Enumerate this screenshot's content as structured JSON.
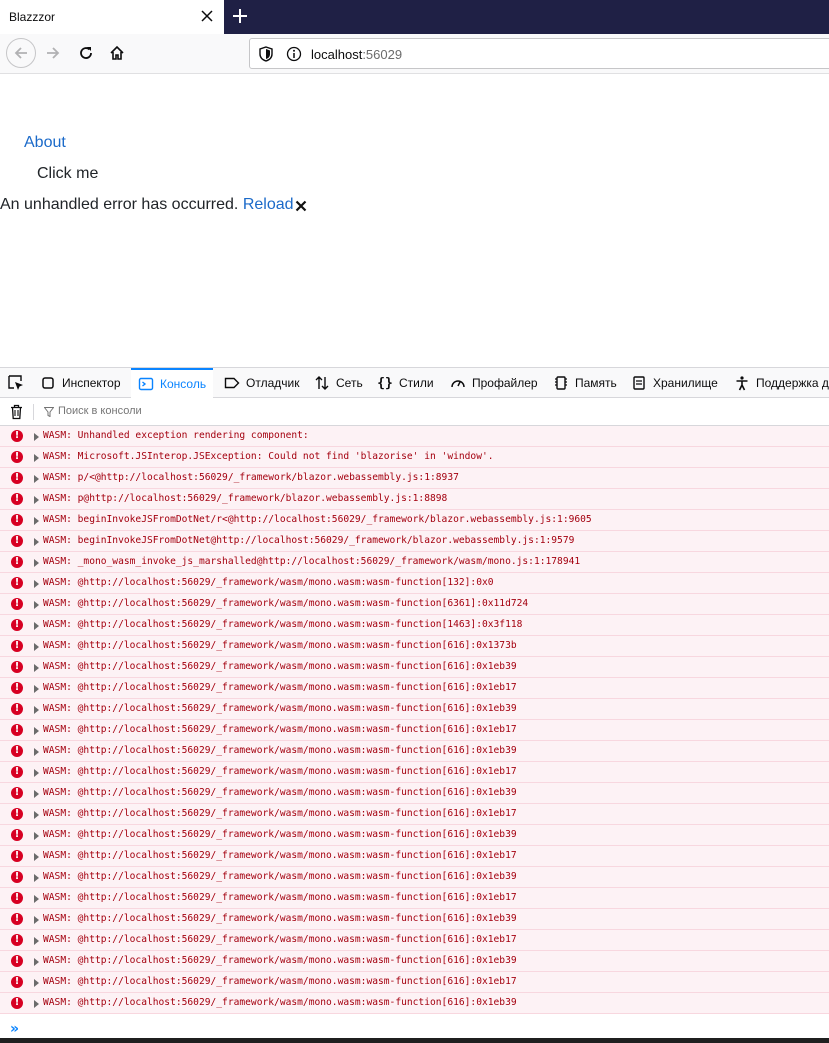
{
  "browser": {
    "tab_title": "Blazzzor",
    "url_host": "localhost",
    "url_port": ":56029"
  },
  "page": {
    "about_link": "About",
    "click_button": "Click me",
    "error_text": "An unhandled error has occurred.",
    "reload_link": "Reload"
  },
  "devtools": {
    "tabs": [
      "Инспектор",
      "Консоль",
      "Отладчик",
      "Сеть",
      "Стили",
      "Профайлер",
      "Память",
      "Хранилище",
      "Поддержка д"
    ],
    "active_tab": "Консоль",
    "filter_placeholder": "Поиск в консоли",
    "messages": [
      "WASM: Unhandled exception rendering component:",
      "WASM: Microsoft.JSInterop.JSException: Could not find 'blazorise' in 'window'.",
      "WASM: p/<@http://localhost:56029/_framework/blazor.webassembly.js:1:8937",
      "WASM: p@http://localhost:56029/_framework/blazor.webassembly.js:1:8898",
      "WASM: beginInvokeJSFromDotNet/r<@http://localhost:56029/_framework/blazor.webassembly.js:1:9605",
      "WASM: beginInvokeJSFromDotNet@http://localhost:56029/_framework/blazor.webassembly.js:1:9579",
      "WASM: _mono_wasm_invoke_js_marshalled@http://localhost:56029/_framework/wasm/mono.js:1:178941",
      "WASM: @http://localhost:56029/_framework/wasm/mono.wasm:wasm-function[132]:0x0",
      "WASM: @http://localhost:56029/_framework/wasm/mono.wasm:wasm-function[6361]:0x11d724",
      "WASM: @http://localhost:56029/_framework/wasm/mono.wasm:wasm-function[1463]:0x3f118",
      "WASM: @http://localhost:56029/_framework/wasm/mono.wasm:wasm-function[616]:0x1373b",
      "WASM: @http://localhost:56029/_framework/wasm/mono.wasm:wasm-function[616]:0x1eb39",
      "WASM: @http://localhost:56029/_framework/wasm/mono.wasm:wasm-function[616]:0x1eb17",
      "WASM: @http://localhost:56029/_framework/wasm/mono.wasm:wasm-function[616]:0x1eb39",
      "WASM: @http://localhost:56029/_framework/wasm/mono.wasm:wasm-function[616]:0x1eb17",
      "WASM: @http://localhost:56029/_framework/wasm/mono.wasm:wasm-function[616]:0x1eb39",
      "WASM: @http://localhost:56029/_framework/wasm/mono.wasm:wasm-function[616]:0x1eb17",
      "WASM: @http://localhost:56029/_framework/wasm/mono.wasm:wasm-function[616]:0x1eb39",
      "WASM: @http://localhost:56029/_framework/wasm/mono.wasm:wasm-function[616]:0x1eb17",
      "WASM: @http://localhost:56029/_framework/wasm/mono.wasm:wasm-function[616]:0x1eb39",
      "WASM: @http://localhost:56029/_framework/wasm/mono.wasm:wasm-function[616]:0x1eb17",
      "WASM: @http://localhost:56029/_framework/wasm/mono.wasm:wasm-function[616]:0x1eb39",
      "WASM: @http://localhost:56029/_framework/wasm/mono.wasm:wasm-function[616]:0x1eb17",
      "WASM: @http://localhost:56029/_framework/wasm/mono.wasm:wasm-function[616]:0x1eb39",
      "WASM: @http://localhost:56029/_framework/wasm/mono.wasm:wasm-function[616]:0x1eb17",
      "WASM: @http://localhost:56029/_framework/wasm/mono.wasm:wasm-function[616]:0x1eb39",
      "WASM: @http://localhost:56029/_framework/wasm/mono.wasm:wasm-function[616]:0x1eb17",
      "WASM: @http://localhost:56029/_framework/wasm/mono.wasm:wasm-function[616]:0x1eb39"
    ]
  },
  "colors": {
    "error_text": "#a4000f",
    "error_row_bg": "#fdf2f5",
    "link": "#1b6ac9",
    "accent": "#0a84ff",
    "tabstrip": "#1f2045"
  }
}
